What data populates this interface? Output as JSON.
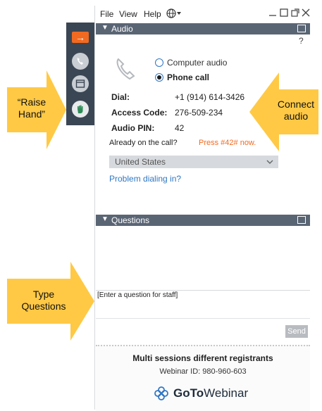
{
  "menu": {
    "file": "File",
    "view": "View",
    "help": "Help"
  },
  "audio": {
    "header": "Audio",
    "help_mark": "?",
    "computer_audio": "Computer audio",
    "phone_call": "Phone call",
    "dial_label": "Dial:",
    "dial_value": "+1 (914) 614-3426",
    "access_label": "Access Code:",
    "access_value": "276-509-234",
    "pin_label": "Audio PIN:",
    "pin_value": "42",
    "already_text": "Already on the call?",
    "press_text": "Press #42# now.",
    "country": "United States",
    "problem_link": "Problem dialing in?"
  },
  "questions": {
    "header": "Questions",
    "placeholder": "[Enter a question for staff]",
    "send_label": "Send"
  },
  "footer": {
    "title": "Multi sessions different registrants",
    "webinar_id": "Webinar ID: 980-960-603",
    "brand_goto": "GoTo",
    "brand_webinar": "Webinar"
  },
  "callouts": {
    "raise_hand": "“Raise\nHand”",
    "connect_audio": "Connect\naudio",
    "type_questions": "Type\nQuestions"
  },
  "colors": {
    "accent_orange": "#f26a21",
    "callout_yellow": "#ffc945",
    "header_gray": "#5a6574",
    "link_blue": "#2f77c4"
  }
}
